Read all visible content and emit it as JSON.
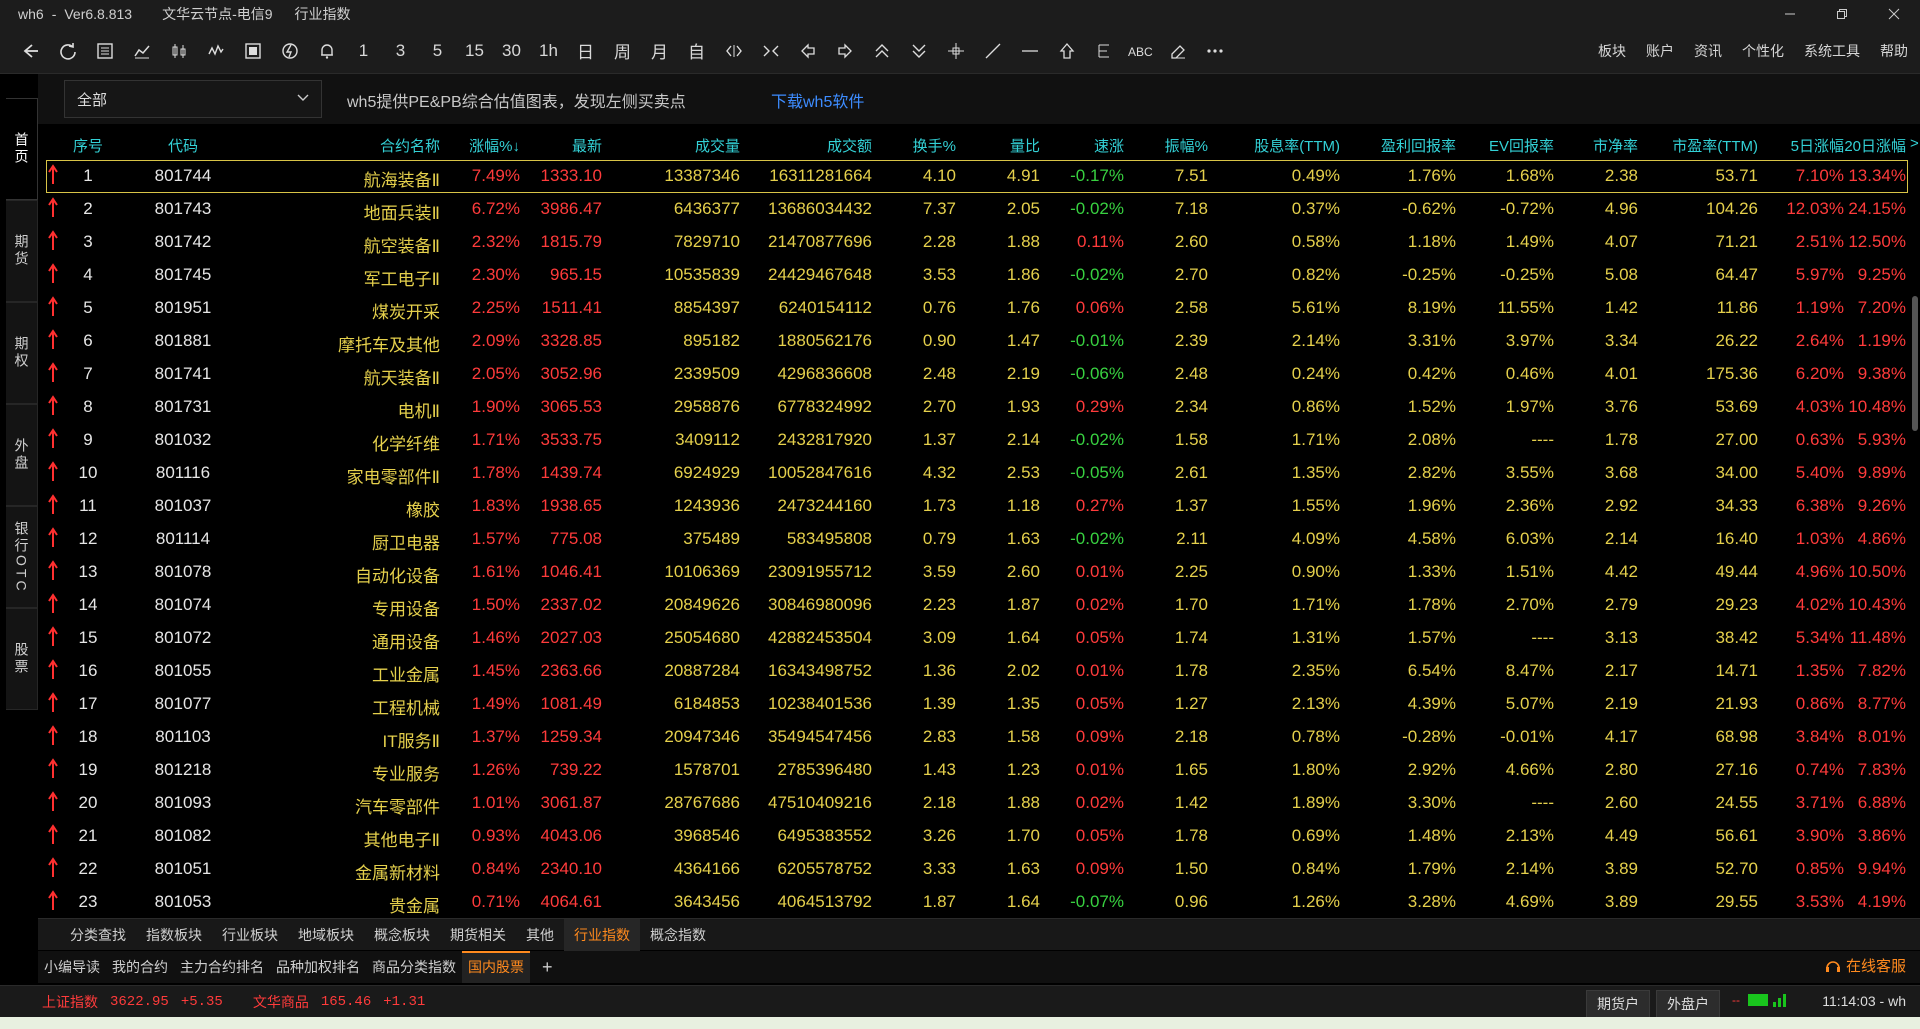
{
  "window": {
    "app": "wh6",
    "version": "Ver6.8.813",
    "server": "文华云节点-电信9",
    "view": "行业指数",
    "minimize_icon": "minimize-icon",
    "restore_icon": "restore-icon",
    "close_icon": "close-icon"
  },
  "toolbar": {
    "text_icons": [
      "1",
      "3",
      "5",
      "15",
      "30",
      "1h",
      "日",
      "周",
      "月",
      "自"
    ],
    "menu": [
      "板块",
      "账户",
      "资讯",
      "个性化",
      "系统工具",
      "帮助"
    ]
  },
  "left_tabs": [
    "首页",
    "期货",
    "期权",
    "外盘",
    "银行OTC",
    "股票"
  ],
  "filter": {
    "dropdown_value": "全部",
    "ad_text": "wh5提供PE&PB综合估值图表，发现左侧买卖点",
    "ad_link": "下载wh5软件"
  },
  "table": {
    "headers": [
      "序号",
      "代码",
      "合约名称",
      "涨幅%↓",
      "最新",
      "成交量",
      "成交额",
      "换手%",
      "量比",
      "速涨",
      "振幅%",
      "股息率(TTM)",
      "盈利回报率",
      "EV回报率",
      "市净率",
      "市盈率(TTM)",
      "5日涨幅",
      "20日涨幅"
    ],
    "more_indicator": ">",
    "rows": [
      [
        "1",
        "801744",
        "航海装备Ⅱ",
        "7.49%",
        "1333.10",
        "13387346",
        "16311281664",
        "4.10",
        "4.91",
        "-0.17%",
        "7.51",
        "0.49%",
        "1.76%",
        "1.68%",
        "2.38",
        "53.71",
        "7.10%",
        "13.34%"
      ],
      [
        "2",
        "801743",
        "地面兵装Ⅱ",
        "6.72%",
        "3986.47",
        "6436377",
        "13686034432",
        "7.37",
        "2.05",
        "-0.02%",
        "7.18",
        "0.37%",
        "-0.62%",
        "-0.72%",
        "4.96",
        "104.26",
        "12.03%",
        "24.15%"
      ],
      [
        "3",
        "801742",
        "航空装备Ⅱ",
        "2.32%",
        "1815.79",
        "7829710",
        "21470877696",
        "2.28",
        "1.88",
        "0.11%",
        "2.60",
        "0.58%",
        "1.18%",
        "1.49%",
        "4.07",
        "71.21",
        "2.51%",
        "12.50%"
      ],
      [
        "4",
        "801745",
        "军工电子Ⅱ",
        "2.30%",
        "965.15",
        "10535839",
        "24429467648",
        "3.53",
        "1.86",
        "-0.02%",
        "2.70",
        "0.82%",
        "-0.25%",
        "-0.25%",
        "5.08",
        "64.47",
        "5.97%",
        "9.25%"
      ],
      [
        "5",
        "801951",
        "煤炭开采",
        "2.25%",
        "1511.41",
        "8854397",
        "6240154112",
        "0.76",
        "1.76",
        "0.06%",
        "2.58",
        "5.61%",
        "8.19%",
        "11.55%",
        "1.42",
        "11.86",
        "1.19%",
        "7.20%"
      ],
      [
        "6",
        "801881",
        "摩托车及其他",
        "2.09%",
        "3328.85",
        "895182",
        "1880562176",
        "0.90",
        "1.47",
        "-0.01%",
        "2.39",
        "2.14%",
        "3.31%",
        "3.97%",
        "3.34",
        "26.22",
        "2.64%",
        "1.19%"
      ],
      [
        "7",
        "801741",
        "航天装备Ⅱ",
        "2.05%",
        "3052.96",
        "2339509",
        "4296836608",
        "2.48",
        "2.19",
        "-0.06%",
        "2.48",
        "0.24%",
        "0.42%",
        "0.46%",
        "4.01",
        "175.36",
        "6.20%",
        "9.38%"
      ],
      [
        "8",
        "801731",
        "电机Ⅱ",
        "1.90%",
        "3065.53",
        "2958876",
        "6778324992",
        "2.70",
        "1.93",
        "0.29%",
        "2.34",
        "0.86%",
        "1.52%",
        "1.97%",
        "3.76",
        "53.69",
        "4.03%",
        "10.48%"
      ],
      [
        "9",
        "801032",
        "化学纤维",
        "1.71%",
        "3533.75",
        "3409112",
        "2432817920",
        "1.37",
        "2.14",
        "-0.02%",
        "1.58",
        "1.71%",
        "2.08%",
        "----",
        "1.78",
        "27.00",
        "0.63%",
        "5.93%"
      ],
      [
        "10",
        "801116",
        "家电零部件Ⅱ",
        "1.78%",
        "1439.74",
        "6924929",
        "10052847616",
        "4.32",
        "2.53",
        "-0.05%",
        "2.61",
        "1.35%",
        "2.82%",
        "3.55%",
        "3.68",
        "34.00",
        "5.40%",
        "9.89%"
      ],
      [
        "11",
        "801037",
        "橡胶",
        "1.83%",
        "1938.65",
        "1243936",
        "2473244160",
        "1.73",
        "1.18",
        "0.27%",
        "1.37",
        "1.55%",
        "1.96%",
        "2.36%",
        "2.92",
        "34.33",
        "6.38%",
        "9.26%"
      ],
      [
        "12",
        "801114",
        "厨卫电器",
        "1.57%",
        "775.08",
        "375489",
        "583495808",
        "0.79",
        "1.63",
        "-0.02%",
        "2.11",
        "4.09%",
        "4.58%",
        "6.03%",
        "2.14",
        "16.40",
        "1.03%",
        "4.86%"
      ],
      [
        "13",
        "801078",
        "自动化设备",
        "1.61%",
        "1046.41",
        "10106369",
        "23091955712",
        "3.59",
        "2.60",
        "0.01%",
        "2.25",
        "0.90%",
        "1.33%",
        "1.51%",
        "4.42",
        "49.44",
        "4.96%",
        "10.50%"
      ],
      [
        "14",
        "801074",
        "专用设备",
        "1.50%",
        "2337.02",
        "20849626",
        "30846980096",
        "2.23",
        "1.87",
        "0.02%",
        "1.70",
        "1.71%",
        "1.78%",
        "2.70%",
        "2.79",
        "29.23",
        "4.02%",
        "10.43%"
      ],
      [
        "15",
        "801072",
        "通用设备",
        "1.46%",
        "2027.03",
        "25054680",
        "42882453504",
        "3.09",
        "1.64",
        "0.05%",
        "1.74",
        "1.31%",
        "1.57%",
        "----",
        "3.13",
        "38.42",
        "5.34%",
        "11.48%"
      ],
      [
        "16",
        "801055",
        "工业金属",
        "1.45%",
        "2363.66",
        "20887284",
        "16343498752",
        "1.36",
        "2.02",
        "0.01%",
        "1.78",
        "2.35%",
        "6.54%",
        "8.47%",
        "2.17",
        "14.71",
        "1.35%",
        "7.82%"
      ],
      [
        "17",
        "801077",
        "工程机械",
        "1.49%",
        "1081.49",
        "6184853",
        "10238401536",
        "1.39",
        "1.35",
        "0.05%",
        "1.27",
        "2.13%",
        "4.39%",
        "5.07%",
        "2.19",
        "21.93",
        "0.86%",
        "8.77%"
      ],
      [
        "18",
        "801103",
        "IT服务Ⅱ",
        "1.37%",
        "1259.34",
        "20947346",
        "35494547456",
        "2.83",
        "1.58",
        "0.09%",
        "2.18",
        "0.78%",
        "-0.28%",
        "-0.01%",
        "4.17",
        "68.98",
        "3.84%",
        "8.01%"
      ],
      [
        "19",
        "801218",
        "专业服务",
        "1.26%",
        "739.22",
        "1578701",
        "2785396480",
        "1.43",
        "1.23",
        "0.01%",
        "1.65",
        "1.80%",
        "2.92%",
        "4.66%",
        "2.80",
        "27.16",
        "0.74%",
        "7.83%"
      ],
      [
        "20",
        "801093",
        "汽车零部件",
        "1.01%",
        "3061.87",
        "28767686",
        "47510409216",
        "2.18",
        "1.88",
        "0.02%",
        "1.42",
        "1.89%",
        "3.30%",
        "----",
        "2.60",
        "24.55",
        "3.71%",
        "6.88%"
      ],
      [
        "21",
        "801082",
        "其他电子Ⅱ",
        "0.93%",
        "4043.06",
        "3968546",
        "6495383552",
        "3.26",
        "1.70",
        "0.05%",
        "1.78",
        "0.69%",
        "1.48%",
        "2.13%",
        "4.49",
        "56.61",
        "3.90%",
        "3.86%"
      ],
      [
        "22",
        "801051",
        "金属新材料",
        "0.84%",
        "2340.10",
        "4364166",
        "6205578752",
        "3.33",
        "1.63",
        "0.09%",
        "1.50",
        "0.84%",
        "1.79%",
        "2.14%",
        "3.89",
        "52.70",
        "0.85%",
        "9.94%"
      ],
      [
        "23",
        "801053",
        "贵金属",
        "0.71%",
        "4064.61",
        "3643456",
        "4064513792",
        "1.87",
        "1.64",
        "-0.07%",
        "0.96",
        "1.26%",
        "3.28%",
        "4.69%",
        "3.89",
        "29.55",
        "3.53%",
        "4.19%"
      ]
    ]
  },
  "category_tabs": [
    "分类查找",
    "指数板块",
    "行业板块",
    "地域板块",
    "概念板块",
    "期货相关",
    "其他",
    "行业指数",
    "概念指数"
  ],
  "category_active": "行业指数",
  "workspace_tabs": [
    "小编导读",
    "我的合约",
    "主力合约排名",
    "品种加权排名",
    "商品分类指数",
    "国内股票"
  ],
  "workspace_active": "国内股票",
  "service": "在线客服",
  "status": {
    "index1_label": "上证指数",
    "index1_value": "3622.95",
    "index1_change": "+5.35",
    "index2_label": "文华商品",
    "index2_value": "165.46",
    "index2_change": "+1.31",
    "btn1": "期货户",
    "btn2": "外盘户",
    "clock": "11:14:03 - wh"
  },
  "colors": {
    "up": "#ff3b3b",
    "down": "#38d140",
    "name": "#e5d04c",
    "header": "#33d1d6",
    "active_tab": "#ff8a1e",
    "link": "#3d8cff"
  }
}
